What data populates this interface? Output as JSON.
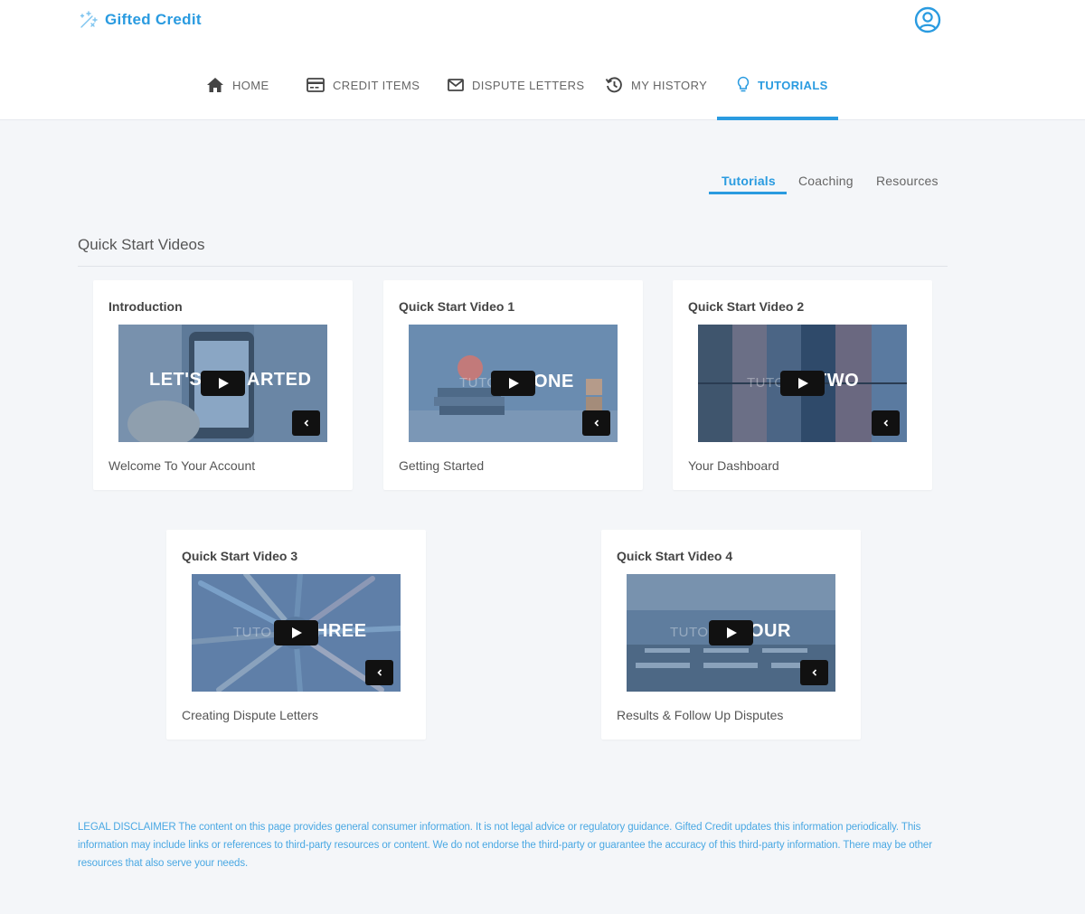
{
  "brand": {
    "name": "Gifted Credit",
    "accent": "#2a9be0"
  },
  "header": {
    "profile_icon": "user-circle-icon"
  },
  "nav": {
    "items": [
      {
        "label": "HOME",
        "icon": "home-icon"
      },
      {
        "label": "CREDIT ITEMS",
        "icon": "credit-card-icon"
      },
      {
        "label": "DISPUTE LETTERS",
        "icon": "envelope-icon"
      },
      {
        "label": "MY HISTORY",
        "icon": "history-icon"
      },
      {
        "label": "TUTORIALS",
        "icon": "lightbulb-icon",
        "active": true
      }
    ]
  },
  "tabs": {
    "items": [
      {
        "label": "Tutorials",
        "active": true
      },
      {
        "label": "Coaching"
      },
      {
        "label": "Resources"
      }
    ]
  },
  "section": {
    "title": "Quick Start Videos"
  },
  "videos": [
    {
      "title": "Introduction",
      "description": "Welcome To Your Account",
      "thumb_text_left": "LET'S G",
      "thumb_text_right": "ARTED"
    },
    {
      "title": "Quick Start Video 1",
      "description": "Getting Started",
      "thumb_text_left": "TUTO",
      "thumb_text_right": "ONE"
    },
    {
      "title": "Quick Start Video 2",
      "description": "Your Dashboard",
      "thumb_text_left": "TUTO",
      "thumb_text_right": "TWO"
    },
    {
      "title": "Quick Start Video 3",
      "description": "Creating Dispute Letters",
      "thumb_text_left": "TUTO",
      "thumb_text_right": "HREE"
    },
    {
      "title": "Quick Start Video 4",
      "description": "Results & Follow Up Disputes",
      "thumb_text_left": "TUTO",
      "thumb_text_right": "OUR"
    }
  ],
  "footer": {
    "disclaimer": "LEGAL DISCLAIMER The content on this page provides general consumer information. It is not legal advice or regulatory guidance. Gifted Credit updates this information periodically. This information may include links or references to third-party resources or content. We do not endorse the third-party or guarantee the accuracy of this third-party information. There may be other resources that also serve your needs."
  }
}
